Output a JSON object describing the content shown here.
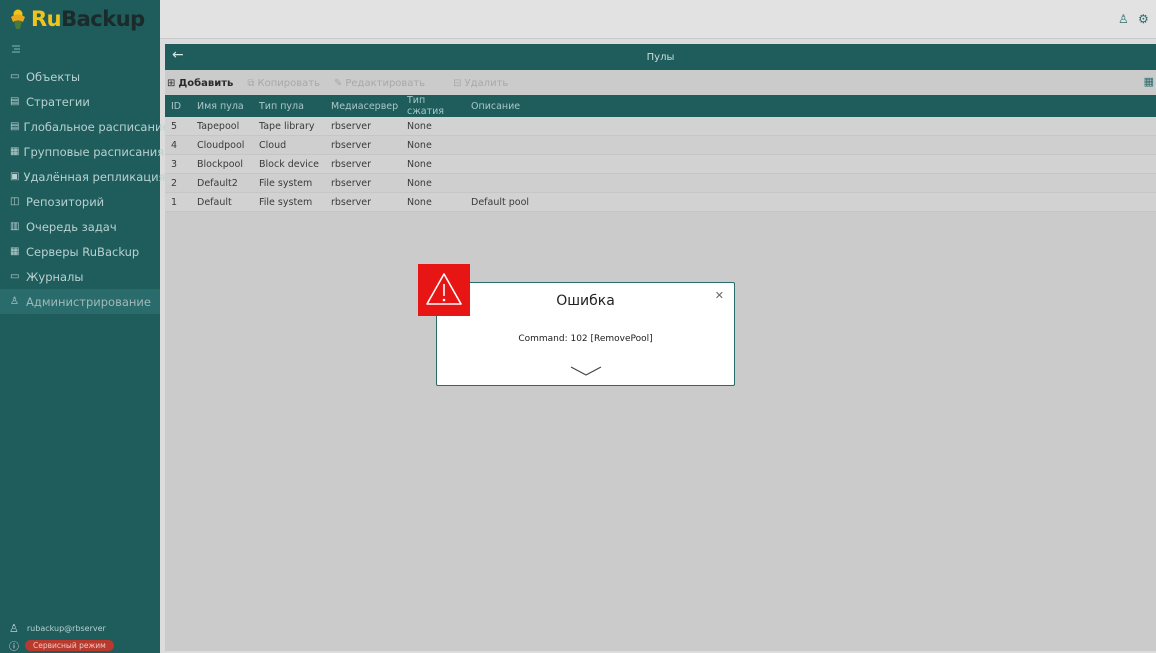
{
  "app": {
    "logo_ru": "Ru",
    "logo_rest": "Backup"
  },
  "sidebar": {
    "items": [
      {
        "label": "Объекты",
        "icon": "monitor-icon"
      },
      {
        "label": "Стратегии",
        "icon": "document-icon"
      },
      {
        "label": "Глобальное расписание",
        "icon": "list-icon"
      },
      {
        "label": "Групповые расписания",
        "icon": "calendar-group-icon"
      },
      {
        "label": "Удалённая репликация",
        "icon": "replication-icon"
      },
      {
        "label": "Репозиторий",
        "icon": "repository-icon"
      },
      {
        "label": "Очередь задач",
        "icon": "queue-icon"
      },
      {
        "label": "Серверы RuBackup",
        "icon": "server-icon"
      },
      {
        "label": "Журналы",
        "icon": "log-icon"
      },
      {
        "label": "Администрирование",
        "icon": "admin-icon"
      }
    ],
    "user": "rubackup@rbserver",
    "mode": "Сервисный режим"
  },
  "panel": {
    "title": "Пулы",
    "toolbar": {
      "add": "Добавить",
      "copy": "Копировать",
      "edit": "Редактировать",
      "delete": "Удалить"
    },
    "columns": [
      "ID",
      "Имя пула",
      "Тип пула",
      "Медиасервер",
      "Тип сжатия",
      "Описание"
    ],
    "rows": [
      [
        "5",
        "Tapepool",
        "Tape library",
        "rbserver",
        "None",
        ""
      ],
      [
        "4",
        "Cloudpool",
        "Cloud",
        "rbserver",
        "None",
        ""
      ],
      [
        "3",
        "Blockpool",
        "Block device",
        "rbserver",
        "None",
        ""
      ],
      [
        "2",
        "Default2",
        "File system",
        "rbserver",
        "None",
        ""
      ],
      [
        "1",
        "Default",
        "File system",
        "rbserver",
        "None",
        "Default pool"
      ]
    ]
  },
  "dialog": {
    "title": "Ошибка",
    "message": "Command: 102 [RemovePool]"
  },
  "colors": {
    "sidebar": "#1f5c5c",
    "accent": "#2a6b6b",
    "error": "#e81515",
    "service_mode": "#b83a2e"
  }
}
